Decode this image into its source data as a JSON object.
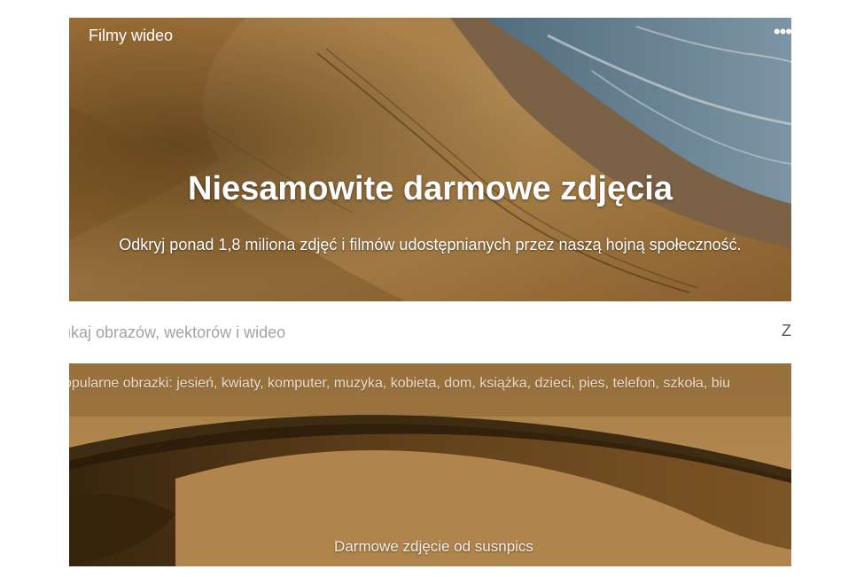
{
  "hero": {
    "nav_label": "Filmy wideo",
    "more_icon": "ellipsis-icon",
    "more_glyph": "•••",
    "title": "Niesamowite darmowe zdjęcia",
    "subtitle": "Odkryj ponad 1,8 miliona zdjęć i filmów udostępnianych przez naszą hojną społeczność."
  },
  "search": {
    "placeholder": "ukaj obrazów, wektorów i wideo",
    "button_label": "Z"
  },
  "panel": {
    "popular_text": "opularne obrazki: jesień, kwiaty, komputer, muzyka, kobieta, dom, książka, dzieci, pies, telefon, szkoła, biu",
    "credit": "Darmowe zdjęcie od susnpics"
  },
  "colors": {
    "sand_light": "#c99a55",
    "sand_dark": "#6e4a1f",
    "sea": "#7a98ad"
  }
}
